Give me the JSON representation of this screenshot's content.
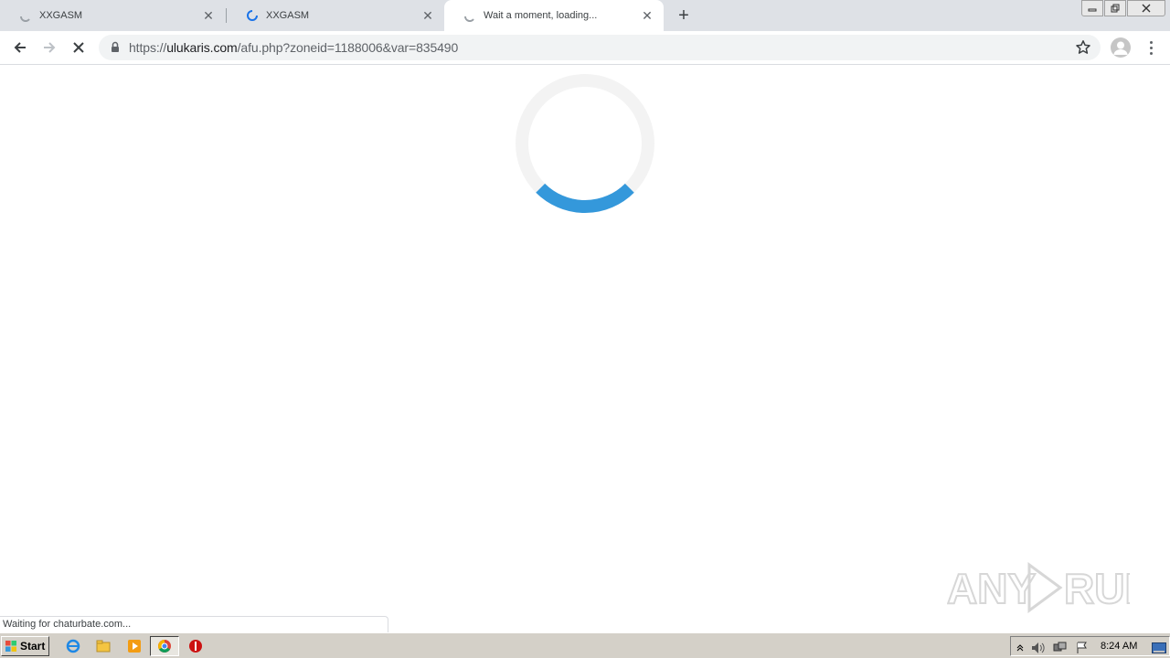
{
  "browser": {
    "tabs": [
      {
        "title": "XXGASM",
        "active": false
      },
      {
        "title": "XXGASM",
        "active": false
      },
      {
        "title": "Wait a moment, loading...",
        "active": true
      }
    ],
    "new_tab_label": "+",
    "url": {
      "scheme": "https://",
      "host": "ulukaris.com",
      "path": "/afu.php?zoneid=1188006&var=835490"
    }
  },
  "page": {
    "status_text": "Waiting for chaturbate.com...",
    "watermark_text": "ANY RUN"
  },
  "taskbar": {
    "start_label": "Start",
    "clock": "8:24 AM"
  },
  "colors": {
    "loader_arc": "#3498db",
    "loader_track": "#f3f3f3",
    "tab_strip": "#dee1e6"
  }
}
